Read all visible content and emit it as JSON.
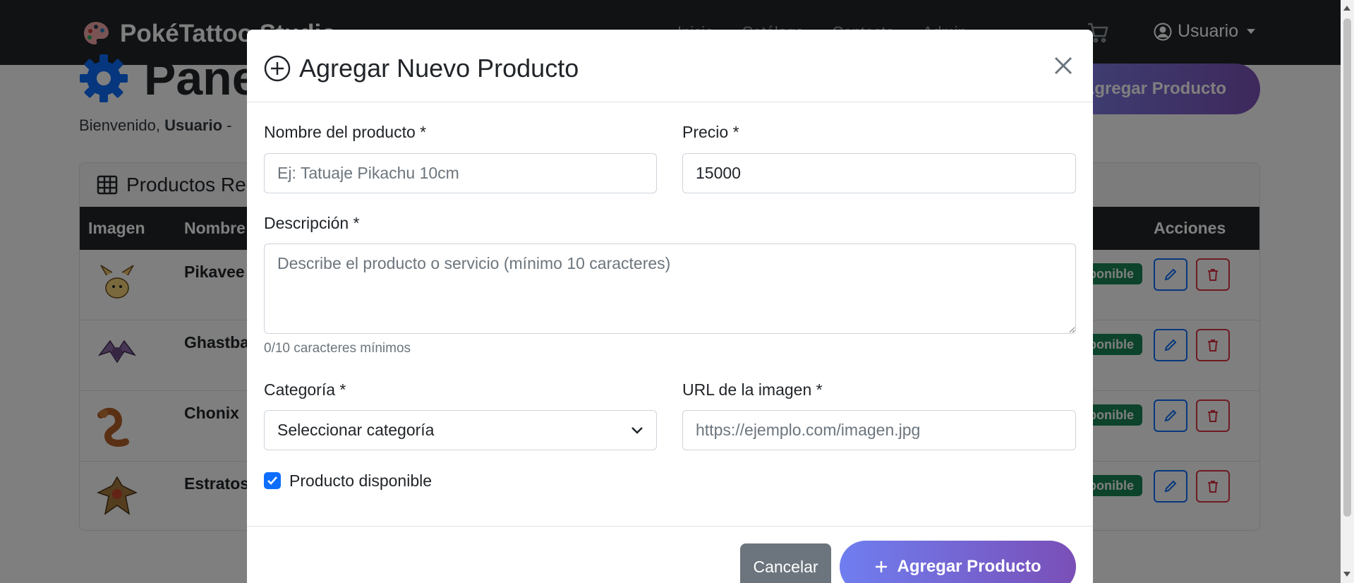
{
  "navbar": {
    "brand": "PokéTattoo Studio",
    "links": [
      "Inicio",
      "Catálogo",
      "Contacto",
      "Admin"
    ],
    "user": "Usuario"
  },
  "page": {
    "title": "Panel de Administración",
    "welcome_prefix": "Bienvenido,",
    "welcome_user": "Usuario",
    "welcome_suffix": "-",
    "add_button": "Agregar Producto"
  },
  "table": {
    "title": "Productos Registrados",
    "headers": {
      "image": "Imagen",
      "name": "Nombre",
      "actions": "Acciones"
    },
    "rows": [
      {
        "name": "Pikavee",
        "badge": "Disponible"
      },
      {
        "name": "Ghastbat",
        "badge": "Disponible"
      },
      {
        "name": "Chonix",
        "badge": "Disponible"
      },
      {
        "name": "Estratos",
        "badge": "Disponible"
      }
    ]
  },
  "modal": {
    "title": "Agregar Nuevo Producto",
    "name_label": "Nombre del producto *",
    "name_placeholder": "Ej: Tatuaje Pikachu 10cm",
    "price_label": "Precio *",
    "price_value": "15000",
    "description_label": "Descripción *",
    "description_placeholder": "Describe el producto o servicio (mínimo 10 caracteres)",
    "description_hint": "0/10 caracteres mínimos",
    "category_label": "Categoría *",
    "category_selected": "Seleccionar categoría",
    "image_label": "URL de la imagen *",
    "image_placeholder": "https://ejemplo.com/imagen.jpg",
    "available_label": "Producto disponible",
    "available_checked": true,
    "cancel_button": "Cancelar",
    "submit_button": "Agregar Producto"
  },
  "colors": {
    "primary": "#0d6efd",
    "danger": "#dc3545",
    "success": "#198754",
    "gradient_start": "#6f7ef0",
    "gradient_end": "#7a4fb7"
  }
}
